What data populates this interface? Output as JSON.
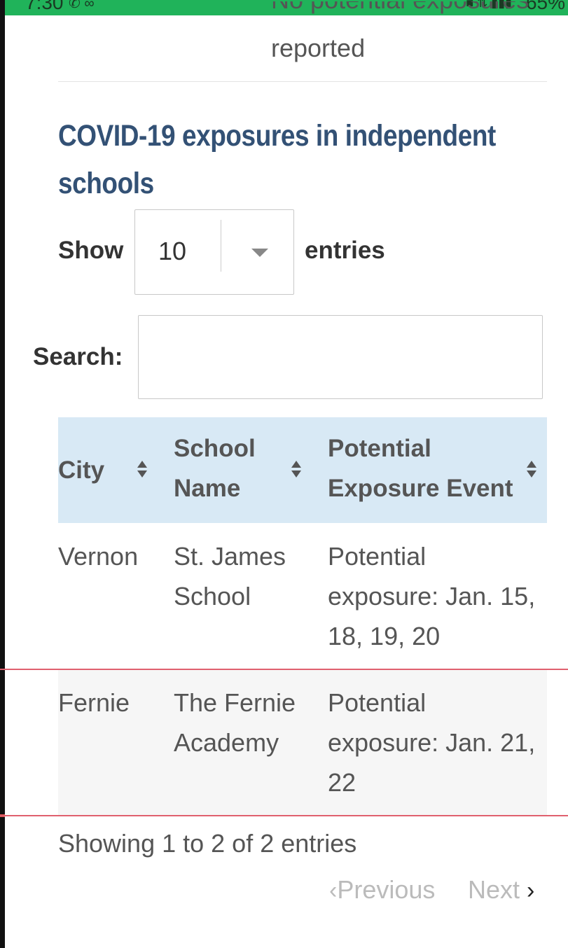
{
  "status_bar": {
    "time": "7:30",
    "battery": "65%",
    "icons": [
      "phone-icon",
      "voicemail-icon",
      "alarm-icon",
      "signal-icon"
    ]
  },
  "previous_section": {
    "clipped_text": "No potential exposures",
    "last_line": "reported"
  },
  "section": {
    "title": "COVID-19 exposures in independent schools"
  },
  "length_control": {
    "show_label": "Show",
    "selected": "10",
    "entries_label": "entries"
  },
  "search": {
    "label": "Search:",
    "value": "",
    "placeholder": ""
  },
  "table": {
    "headers": [
      "City",
      "School Name",
      "Potential Exposure Event"
    ],
    "header_lines": [
      [
        "City"
      ],
      [
        "School",
        "Name"
      ],
      [
        "Potential",
        "Exposure Event"
      ]
    ],
    "rows": [
      {
        "city": "Vernon",
        "school_lines": [
          "St. James",
          "School"
        ],
        "event_lines": [
          "Potential",
          "exposure: Jan. 15,",
          "18, 19, 20"
        ]
      },
      {
        "city": "Fernie",
        "school_lines": [
          "The Fernie",
          "Academy"
        ],
        "event_lines": [
          "Potential",
          "exposure: Jan. 21,",
          "22"
        ]
      }
    ]
  },
  "footer": {
    "info": "Showing 1 to 2 of 2 entries",
    "previous_label": "Previous",
    "next_label": "Next"
  },
  "colors": {
    "title": "#335175",
    "header_bg": "#d8e9f5",
    "status_bar": "#20b35a",
    "row_divider": "#e0606e"
  }
}
